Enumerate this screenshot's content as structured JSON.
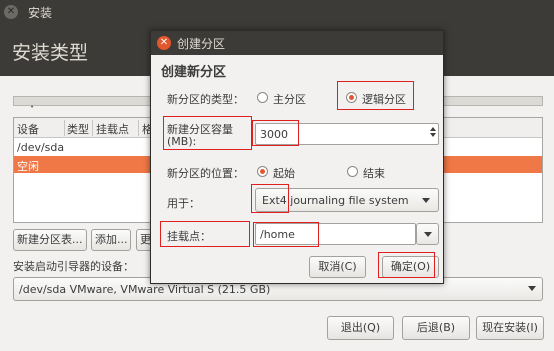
{
  "window": {
    "title": "安装",
    "page_title": "安装类型"
  },
  "table": {
    "headers": [
      "设备",
      "类型",
      "挂载点",
      "格"
    ],
    "rows": [
      "/dev/sda",
      "空闲"
    ]
  },
  "buttons": {
    "new_table": "新建分区表...",
    "add": "添加...",
    "change": "更"
  },
  "bootloader": {
    "label": "安装启动引导器的设备：",
    "value": "/dev/sda  VMware, VMware Virtual S (21.5 GB)"
  },
  "footer": {
    "quit": "退出(Q)",
    "back": "后退(B)",
    "install_now": "现在安装(I)"
  },
  "dialog": {
    "title": "创建分区",
    "heading": "创建新分区",
    "type_label": "新分区的类型：",
    "type_primary": "主分区",
    "type_logical": "逻辑分区",
    "size_label_1": "新建分区容量",
    "size_label_2": "(MB):",
    "size_value": "3000",
    "location_label": "新分区的位置：",
    "location_start": "起始",
    "location_end": "结束",
    "use_label": "用于：",
    "use_value": "Ext4 journaling file system",
    "mount_label": "挂载点：",
    "mount_value": "/home",
    "cancel": "取消(C)",
    "ok": "确定(O)"
  },
  "colors": {
    "accent": "#f07746",
    "titlebar": "#3c3b37",
    "highlight": "#e02020"
  }
}
